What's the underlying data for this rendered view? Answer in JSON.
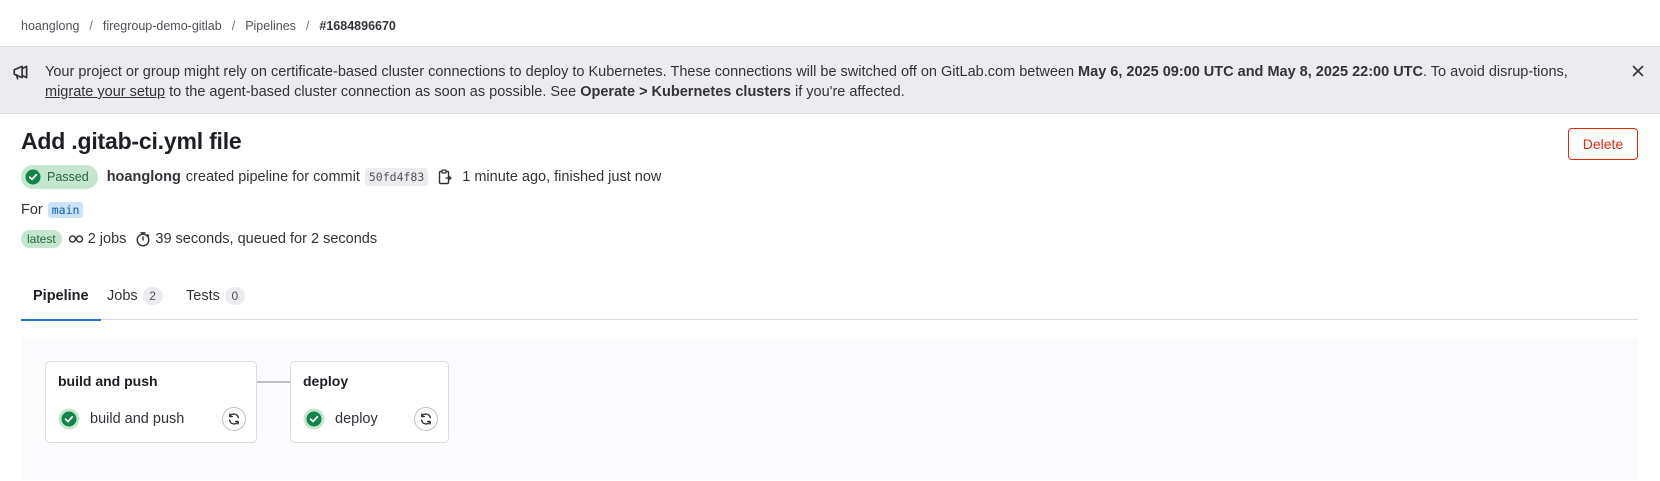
{
  "breadcrumb": {
    "items": [
      "hoanglong",
      "firegroup-demo-gitlab",
      "Pipelines"
    ],
    "current": "#1684896670",
    "separator": "/"
  },
  "banner": {
    "icon": "megaphone-icon",
    "text_1": "Your project or group might rely on certificate-based cluster connections to deploy to Kubernetes. These connections will be switched off on GitLab.com between ",
    "bold_dates": "May 6, 2025 09:00 UTC and May 8, 2025 22:00 UTC",
    "text_2": ". To avoid disrup-tions, ",
    "link": "migrate your setup",
    "text_3": " to the agent-based cluster connection as soon as possible. See ",
    "bold_path": "Operate > Kubernetes clusters",
    "text_4": " if you're affected."
  },
  "pipeline": {
    "title": "Add .gitab-ci.yml file",
    "delete_label": "Delete",
    "status": "Passed",
    "author": "hoanglong",
    "created_text": "created pipeline for commit",
    "commit_sha": "50fd4f83",
    "time_text": "1 minute ago, finished just now",
    "for_label": "For",
    "branch": "main",
    "latest_badge": "latest",
    "jobs_text": "2 jobs",
    "duration_text": "39 seconds, queued for 2 seconds"
  },
  "tabs": [
    {
      "label": "Pipeline",
      "count": null,
      "active": true
    },
    {
      "label": "Jobs",
      "count": "2",
      "active": false
    },
    {
      "label": "Tests",
      "count": "0",
      "active": false
    }
  ],
  "stages": [
    {
      "name": "build and push",
      "jobs": [
        {
          "name": "build and push",
          "status": "success"
        }
      ]
    },
    {
      "name": "deploy",
      "jobs": [
        {
          "name": "deploy",
          "status": "success"
        }
      ]
    }
  ],
  "colors": {
    "success": "#108548",
    "danger": "#dd2b0e",
    "link": "#1f75cb",
    "banner_bg": "#ececef"
  }
}
